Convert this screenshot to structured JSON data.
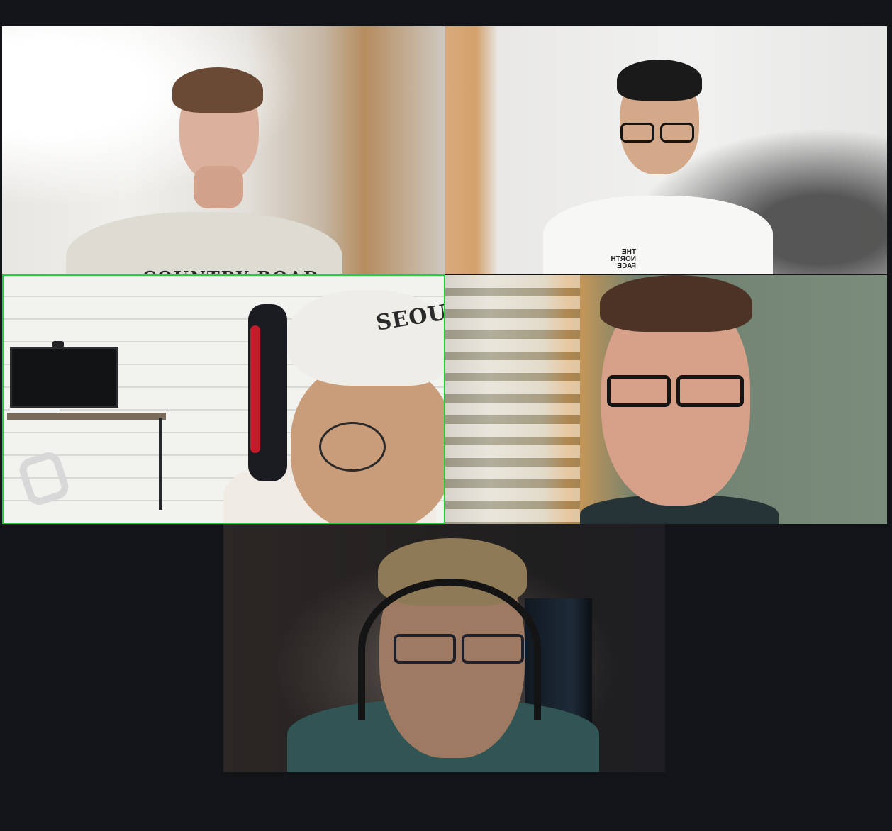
{
  "app": {
    "background_color": "#121417",
    "active_speaker_color": "#22cf3a"
  },
  "participants": [
    {
      "tile": "top-left",
      "active_speaker": false,
      "background_colors": [
        "#f3f3f2",
        "#d5d3cf",
        "#b98c5a"
      ],
      "shirt_text": "COUNTRY ROAD"
    },
    {
      "tile": "top-right",
      "active_speaker": false,
      "background_colors": [
        "#ececea",
        "#d7a56f",
        "#555555"
      ],
      "shirt_logo": "THE NORTH FACE"
    },
    {
      "tile": "middle-left",
      "active_speaker": true,
      "background_colors": [
        "#ededeb",
        "#1d1f23",
        "#7a7a7a"
      ],
      "cap_text": "SEOU"
    },
    {
      "tile": "middle-right",
      "active_speaker": false,
      "background_colors": [
        "#6f806f",
        "#d8d2c2",
        "#273033"
      ]
    },
    {
      "tile": "bottom-center",
      "active_speaker": false,
      "background_colors": [
        "#2a2725",
        "#1c2530",
        "#315454"
      ]
    }
  ]
}
